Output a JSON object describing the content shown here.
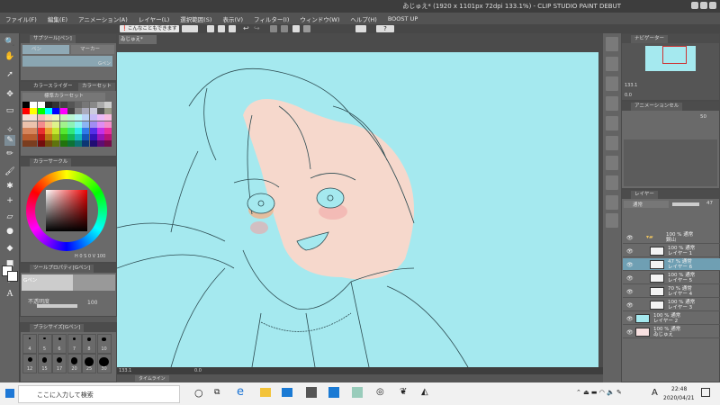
{
  "window": {
    "title": "ゐじゅえ* (1920 x 1101px 72dpi 133.1%)  - CLIP STUDIO PAINT DEBUT"
  },
  "menu": [
    "ファイル(F)",
    "編集(E)",
    "アニメーション(A)",
    "レイヤー(L)",
    "選択範囲(S)",
    "表示(V)",
    "フィルター(I)",
    "ウィンドウ(W)",
    "ヘルプ(H)",
    "BOOST UP"
  ],
  "toolbar": {
    "tips_label": "こんなこともできます"
  },
  "sub_tool": {
    "title": "サブツール[ペン]",
    "tabs": [
      "ペン",
      "マーカー"
    ],
    "brush_name": "Gペン"
  },
  "color_set": {
    "tabs": [
      "カラースライダー",
      "カラーセット"
    ],
    "set_name": "標準カラーセット"
  },
  "color_circle": {
    "title": "カラーサークル",
    "h": "0",
    "s": "0",
    "v": "100"
  },
  "tool_property": {
    "title": "ツールプロパティ[Gペン]",
    "brush_name": "Gペン",
    "opacity_label": "不透明度",
    "opacity_value": "100"
  },
  "brush_size": {
    "title": "ブラシサイズ[Gペン]",
    "sizes": [
      "4",
      "5",
      "6",
      "7",
      "8",
      "10",
      "12",
      "15",
      "17",
      "20",
      "25",
      "30"
    ]
  },
  "document": {
    "tab": "ゐじゅえ*",
    "zoom": "133.1",
    "angle": "0.0"
  },
  "timeline": {
    "title": "タイムライン"
  },
  "navigator": {
    "tabs": [
      "ナビゲーター"
    ],
    "zoom": "133.1",
    "angle": "0.0"
  },
  "animation_cel": {
    "title": "アニメーションセル",
    "value": "50"
  },
  "layers": {
    "title": "レイヤー",
    "blend_mode": "通常",
    "opacity": "47",
    "items": [
      {
        "top": "100 % 通常",
        "name": "鋼山",
        "folder": true
      },
      {
        "top": "100 % 通常",
        "name": "レイヤー 1"
      },
      {
        "top": "47 % 通常",
        "name": "レイヤー 6",
        "selected": true
      },
      {
        "top": "100 % 通常",
        "name": "レイヤー 5"
      },
      {
        "top": "70 % 通常",
        "name": "レイヤー 4"
      },
      {
        "top": "100 % 通常",
        "name": "レイヤー 3"
      },
      {
        "top": "100 % 通常",
        "name": "レイヤー 2"
      },
      {
        "top": "100 % 通常",
        "name": "ゐじゅえ"
      }
    ]
  },
  "taskbar": {
    "search_placeholder": "ここに入力して検索",
    "time": "22:48",
    "date": "2020/04/21",
    "ime": "A"
  },
  "colors": {
    "canvas": "#a5e9ef",
    "accent": "#6f9fb3"
  }
}
